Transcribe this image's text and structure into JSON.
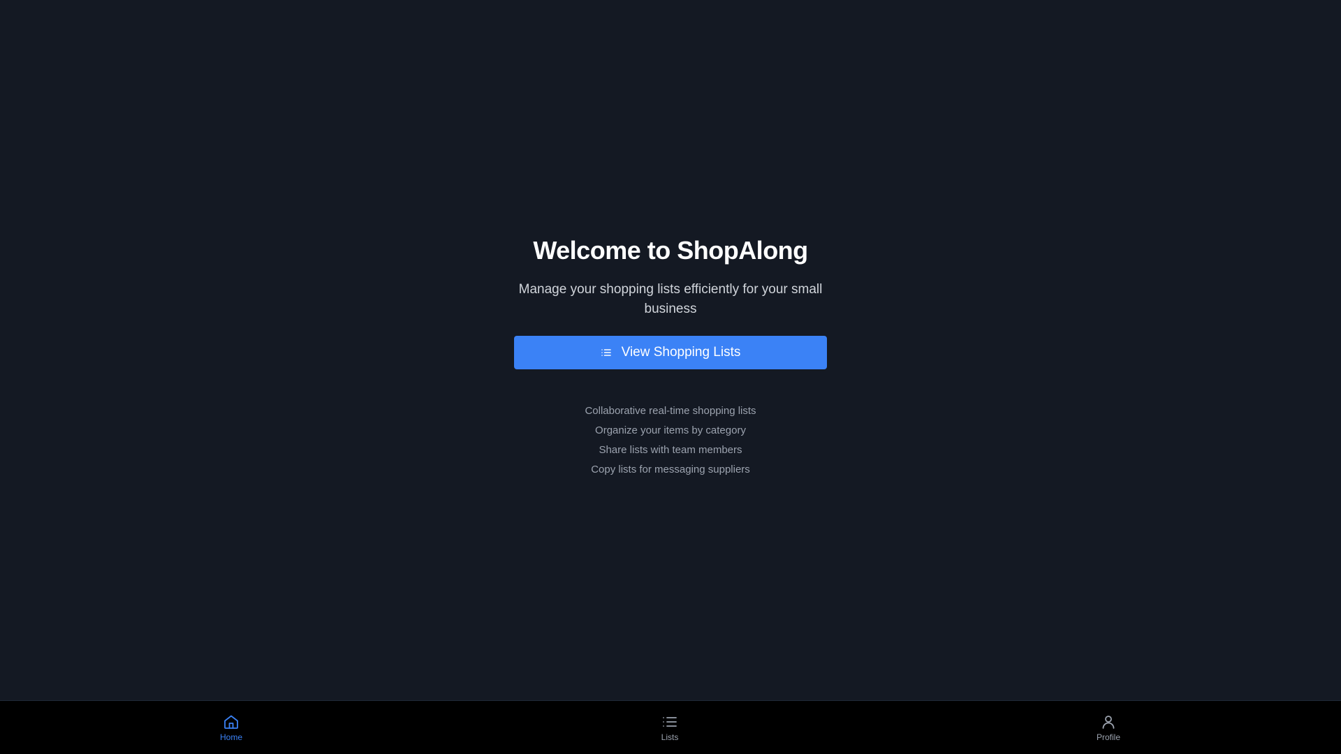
{
  "hero": {
    "title": "Welcome to ShopAlong",
    "subtitle": "Manage your shopping lists efficiently for your small business",
    "cta_label": "View Shopping Lists",
    "cta_icon": "list-icon"
  },
  "features": [
    "Collaborative real-time shopping lists",
    "Organize your items by category",
    "Share lists with team members",
    "Copy lists for messaging suppliers"
  ],
  "nav": {
    "items": [
      {
        "label": "Home",
        "icon": "home-icon",
        "active": true
      },
      {
        "label": "Lists",
        "icon": "list-icon",
        "active": false
      },
      {
        "label": "Profile",
        "icon": "user-icon",
        "active": false
      }
    ]
  },
  "colors": {
    "background": "#141923",
    "accent": "#3b82f6",
    "nav_background": "#000000",
    "muted_text": "#9ca3af"
  }
}
